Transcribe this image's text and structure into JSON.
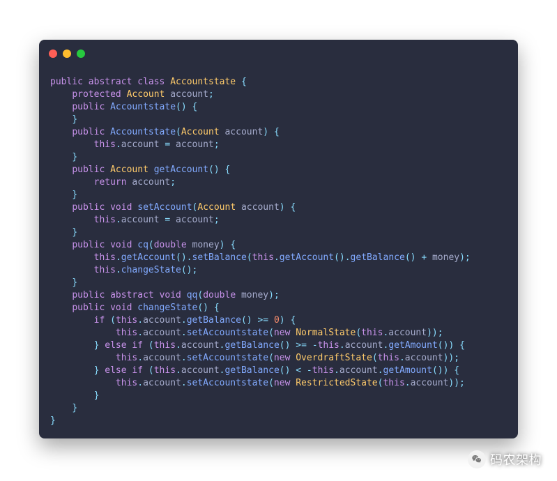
{
  "watermark": {
    "text": "码农架构"
  },
  "code": {
    "lines": [
      [
        [
          "k",
          "public"
        ],
        [
          "d",
          " "
        ],
        [
          "k",
          "abstract"
        ],
        [
          "d",
          " "
        ],
        [
          "k",
          "class"
        ],
        [
          "d",
          " "
        ],
        [
          "t",
          "Accountstate"
        ],
        [
          "d",
          " "
        ],
        [
          "p",
          "{"
        ]
      ],
      [
        [
          "d",
          "    "
        ],
        [
          "k",
          "protected"
        ],
        [
          "d",
          " "
        ],
        [
          "t",
          "Account"
        ],
        [
          "d",
          " "
        ],
        [
          "v",
          "account"
        ],
        [
          "p",
          ";"
        ]
      ],
      [
        [
          "d",
          "    "
        ],
        [
          "k",
          "public"
        ],
        [
          "d",
          " "
        ],
        [
          "f",
          "Accountstate"
        ],
        [
          "p",
          "()"
        ],
        [
          "d",
          " "
        ],
        [
          "p",
          "{"
        ]
      ],
      [
        [
          "d",
          "    "
        ],
        [
          "p",
          "}"
        ]
      ],
      [
        [
          "d",
          "    "
        ],
        [
          "k",
          "public"
        ],
        [
          "d",
          " "
        ],
        [
          "f",
          "Accountstate"
        ],
        [
          "p",
          "("
        ],
        [
          "t",
          "Account"
        ],
        [
          "d",
          " "
        ],
        [
          "v",
          "account"
        ],
        [
          "p",
          ")"
        ],
        [
          "d",
          " "
        ],
        [
          "p",
          "{"
        ]
      ],
      [
        [
          "d",
          "        "
        ],
        [
          "k",
          "this"
        ],
        [
          "p",
          "."
        ],
        [
          "v",
          "account"
        ],
        [
          "d",
          " "
        ],
        [
          "s",
          "="
        ],
        [
          "d",
          " "
        ],
        [
          "v",
          "account"
        ],
        [
          "p",
          ";"
        ]
      ],
      [
        [
          "d",
          "    "
        ],
        [
          "p",
          "}"
        ]
      ],
      [
        [
          "d",
          "    "
        ],
        [
          "k",
          "public"
        ],
        [
          "d",
          " "
        ],
        [
          "t",
          "Account"
        ],
        [
          "d",
          " "
        ],
        [
          "f",
          "getAccount"
        ],
        [
          "p",
          "()"
        ],
        [
          "d",
          " "
        ],
        [
          "p",
          "{"
        ]
      ],
      [
        [
          "d",
          "        "
        ],
        [
          "k",
          "return"
        ],
        [
          "d",
          " "
        ],
        [
          "v",
          "account"
        ],
        [
          "p",
          ";"
        ]
      ],
      [
        [
          "d",
          "    "
        ],
        [
          "p",
          "}"
        ]
      ],
      [
        [
          "d",
          "    "
        ],
        [
          "k",
          "public"
        ],
        [
          "d",
          " "
        ],
        [
          "k",
          "void"
        ],
        [
          "d",
          " "
        ],
        [
          "f",
          "setAccount"
        ],
        [
          "p",
          "("
        ],
        [
          "t",
          "Account"
        ],
        [
          "d",
          " "
        ],
        [
          "v",
          "account"
        ],
        [
          "p",
          ")"
        ],
        [
          "d",
          " "
        ],
        [
          "p",
          "{"
        ]
      ],
      [
        [
          "d",
          "        "
        ],
        [
          "k",
          "this"
        ],
        [
          "p",
          "."
        ],
        [
          "v",
          "account"
        ],
        [
          "d",
          " "
        ],
        [
          "s",
          "="
        ],
        [
          "d",
          " "
        ],
        [
          "v",
          "account"
        ],
        [
          "p",
          ";"
        ]
      ],
      [
        [
          "d",
          "    "
        ],
        [
          "p",
          "}"
        ]
      ],
      [
        [
          "d",
          "    "
        ],
        [
          "k",
          "public"
        ],
        [
          "d",
          " "
        ],
        [
          "k",
          "void"
        ],
        [
          "d",
          " "
        ],
        [
          "f",
          "cq"
        ],
        [
          "p",
          "("
        ],
        [
          "k",
          "double"
        ],
        [
          "d",
          " "
        ],
        [
          "v",
          "money"
        ],
        [
          "p",
          ")"
        ],
        [
          "d",
          " "
        ],
        [
          "p",
          "{"
        ]
      ],
      [
        [
          "d",
          "        "
        ],
        [
          "k",
          "this"
        ],
        [
          "p",
          "."
        ],
        [
          "f",
          "getAccount"
        ],
        [
          "p",
          "()."
        ],
        [
          "f",
          "setBalance"
        ],
        [
          "p",
          "("
        ],
        [
          "k",
          "this"
        ],
        [
          "p",
          "."
        ],
        [
          "f",
          "getAccount"
        ],
        [
          "p",
          "()."
        ],
        [
          "f",
          "getBalance"
        ],
        [
          "p",
          "()"
        ],
        [
          "d",
          " "
        ],
        [
          "s",
          "+"
        ],
        [
          "d",
          " "
        ],
        [
          "v",
          "money"
        ],
        [
          "p",
          ");"
        ]
      ],
      [
        [
          "d",
          "        "
        ],
        [
          "k",
          "this"
        ],
        [
          "p",
          "."
        ],
        [
          "f",
          "changeState"
        ],
        [
          "p",
          "();"
        ]
      ],
      [
        [
          "d",
          "    "
        ],
        [
          "p",
          "}"
        ]
      ],
      [
        [
          "d",
          "    "
        ],
        [
          "k",
          "public"
        ],
        [
          "d",
          " "
        ],
        [
          "k",
          "abstract"
        ],
        [
          "d",
          " "
        ],
        [
          "k",
          "void"
        ],
        [
          "d",
          " "
        ],
        [
          "f",
          "qq"
        ],
        [
          "p",
          "("
        ],
        [
          "k",
          "double"
        ],
        [
          "d",
          " "
        ],
        [
          "v",
          "money"
        ],
        [
          "p",
          ")"
        ],
        [
          "p",
          ";"
        ]
      ],
      [
        [
          "d",
          "    "
        ],
        [
          "k",
          "public"
        ],
        [
          "d",
          " "
        ],
        [
          "k",
          "void"
        ],
        [
          "d",
          " "
        ],
        [
          "f",
          "changeState"
        ],
        [
          "p",
          "()"
        ],
        [
          "d",
          " "
        ],
        [
          "p",
          "{"
        ]
      ],
      [
        [
          "d",
          "        "
        ],
        [
          "k",
          "if"
        ],
        [
          "d",
          " "
        ],
        [
          "p",
          "("
        ],
        [
          "k",
          "this"
        ],
        [
          "p",
          "."
        ],
        [
          "v",
          "account"
        ],
        [
          "p",
          "."
        ],
        [
          "f",
          "getBalance"
        ],
        [
          "p",
          "()"
        ],
        [
          "d",
          " "
        ],
        [
          "s",
          ">="
        ],
        [
          "d",
          " "
        ],
        [
          "n",
          "0"
        ],
        [
          "p",
          ")"
        ],
        [
          "d",
          " "
        ],
        [
          "p",
          "{"
        ]
      ],
      [
        [
          "d",
          "            "
        ],
        [
          "k",
          "this"
        ],
        [
          "p",
          "."
        ],
        [
          "v",
          "account"
        ],
        [
          "p",
          "."
        ],
        [
          "f",
          "setAccountstate"
        ],
        [
          "p",
          "("
        ],
        [
          "k",
          "new"
        ],
        [
          "d",
          " "
        ],
        [
          "t",
          "NormalState"
        ],
        [
          "p",
          "("
        ],
        [
          "k",
          "this"
        ],
        [
          "p",
          "."
        ],
        [
          "v",
          "account"
        ],
        [
          "p",
          "));"
        ]
      ],
      [
        [
          "d",
          "        "
        ],
        [
          "p",
          "}"
        ],
        [
          "d",
          " "
        ],
        [
          "k",
          "else"
        ],
        [
          "d",
          " "
        ],
        [
          "k",
          "if"
        ],
        [
          "d",
          " "
        ],
        [
          "p",
          "("
        ],
        [
          "k",
          "this"
        ],
        [
          "p",
          "."
        ],
        [
          "v",
          "account"
        ],
        [
          "p",
          "."
        ],
        [
          "f",
          "getBalance"
        ],
        [
          "p",
          "()"
        ],
        [
          "d",
          " "
        ],
        [
          "s",
          ">="
        ],
        [
          "d",
          " "
        ],
        [
          "s",
          "-"
        ],
        [
          "k",
          "this"
        ],
        [
          "p",
          "."
        ],
        [
          "v",
          "account"
        ],
        [
          "p",
          "."
        ],
        [
          "f",
          "getAmount"
        ],
        [
          "p",
          "())"
        ],
        [
          "d",
          " "
        ],
        [
          "p",
          "{"
        ]
      ],
      [
        [
          "d",
          "            "
        ],
        [
          "k",
          "this"
        ],
        [
          "p",
          "."
        ],
        [
          "v",
          "account"
        ],
        [
          "p",
          "."
        ],
        [
          "f",
          "setAccountstate"
        ],
        [
          "p",
          "("
        ],
        [
          "k",
          "new"
        ],
        [
          "d",
          " "
        ],
        [
          "t",
          "OverdraftState"
        ],
        [
          "p",
          "("
        ],
        [
          "k",
          "this"
        ],
        [
          "p",
          "."
        ],
        [
          "v",
          "account"
        ],
        [
          "p",
          "));"
        ]
      ],
      [
        [
          "d",
          "        "
        ],
        [
          "p",
          "}"
        ],
        [
          "d",
          " "
        ],
        [
          "k",
          "else"
        ],
        [
          "d",
          " "
        ],
        [
          "k",
          "if"
        ],
        [
          "d",
          " "
        ],
        [
          "p",
          "("
        ],
        [
          "k",
          "this"
        ],
        [
          "p",
          "."
        ],
        [
          "v",
          "account"
        ],
        [
          "p",
          "."
        ],
        [
          "f",
          "getBalance"
        ],
        [
          "p",
          "()"
        ],
        [
          "d",
          " "
        ],
        [
          "s",
          "<"
        ],
        [
          "d",
          " "
        ],
        [
          "s",
          "-"
        ],
        [
          "k",
          "this"
        ],
        [
          "p",
          "."
        ],
        [
          "v",
          "account"
        ],
        [
          "p",
          "."
        ],
        [
          "f",
          "getAmount"
        ],
        [
          "p",
          "())"
        ],
        [
          "d",
          " "
        ],
        [
          "p",
          "{"
        ]
      ],
      [
        [
          "d",
          "            "
        ],
        [
          "k",
          "this"
        ],
        [
          "p",
          "."
        ],
        [
          "v",
          "account"
        ],
        [
          "p",
          "."
        ],
        [
          "f",
          "setAccountstate"
        ],
        [
          "p",
          "("
        ],
        [
          "k",
          "new"
        ],
        [
          "d",
          " "
        ],
        [
          "t",
          "RestrictedState"
        ],
        [
          "p",
          "("
        ],
        [
          "k",
          "this"
        ],
        [
          "p",
          "."
        ],
        [
          "v",
          "account"
        ],
        [
          "p",
          "));"
        ]
      ],
      [
        [
          "d",
          "        "
        ],
        [
          "p",
          "}"
        ]
      ],
      [
        [
          "d",
          "    "
        ],
        [
          "p",
          "}"
        ]
      ],
      [
        [
          "p",
          "}"
        ]
      ]
    ]
  }
}
